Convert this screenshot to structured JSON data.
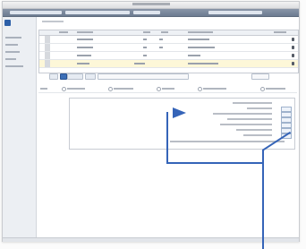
{
  "window": {
    "title_bar": ""
  },
  "toolbar": {
    "segments": 4
  },
  "sidebar": {
    "items": [
      "",
      "",
      "",
      "",
      ""
    ]
  },
  "grid": {
    "rows": 4,
    "selected_row": 3
  },
  "filters": {
    "options": 6
  },
  "panel": {
    "lines": 9
  },
  "colors": {
    "accent": "#3564b8",
    "window_bg": "#f3f3f4",
    "selected_row": "#fdf7d8",
    "toolbar": "#7b889b"
  },
  "icons": [
    "app-logo-icon",
    "row-info-icon",
    "radio-icon"
  ]
}
